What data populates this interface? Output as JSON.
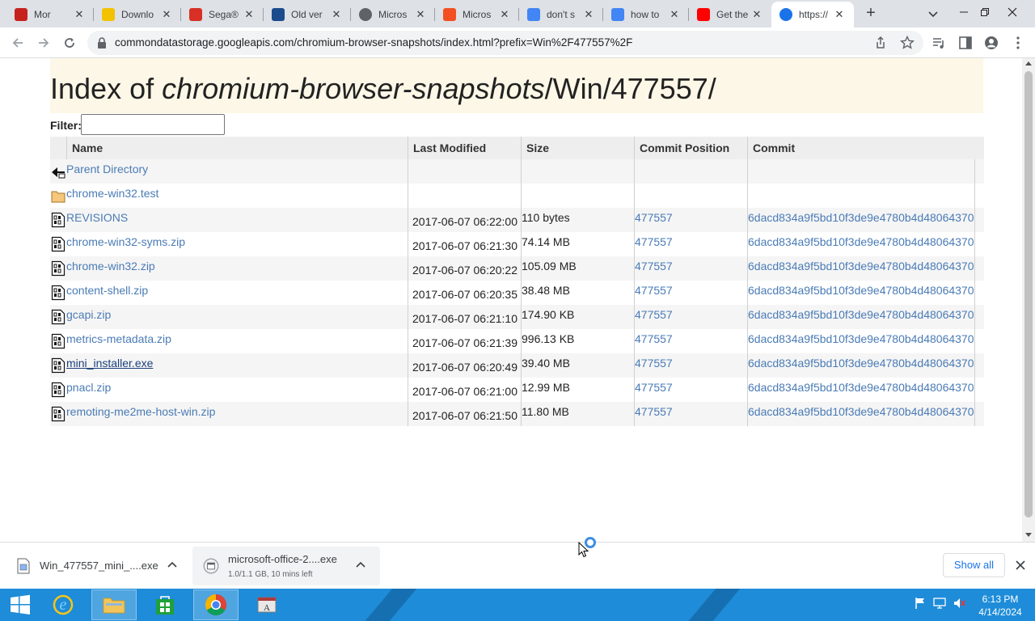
{
  "tabs": [
    {
      "title": "Mor",
      "favicon_color": "#c5221f",
      "favicon": "wolf-icon"
    },
    {
      "title": "Downlo",
      "favicon_color": "#f2c200",
      "favicon": "download-site-icon"
    },
    {
      "title": "Sega®",
      "favicon_color": "#d93025",
      "favicon": "sega-icon"
    },
    {
      "title": "Old ver",
      "favicon_color": "#1a4b8c",
      "favicon": "oldversion-icon"
    },
    {
      "title": "Micros",
      "favicon_color": "#5f6368",
      "favicon": "globe-icon"
    },
    {
      "title": "Micros",
      "favicon_color": "#f25022",
      "favicon": "microsoft-icon"
    },
    {
      "title": "don't s",
      "favicon_color": "#4285f4",
      "favicon": "google-icon"
    },
    {
      "title": "how to",
      "favicon_color": "#4285f4",
      "favicon": "google-icon"
    },
    {
      "title": "Get the",
      "favicon_color": "#ff0000",
      "favicon": "youtube-icon"
    },
    {
      "title": "https://",
      "favicon_color": "#1a73e8",
      "favicon": "globe-icon",
      "active": true
    }
  ],
  "address_bar": {
    "url": "commondatastorage.googleapis.com/chromium-browser-snapshots/index.html?prefix=Win%2F477557%2F"
  },
  "page": {
    "title_prefix": "Index of ",
    "title_italic": "chromium-browser-snapshots",
    "title_suffix": "/Win/477557/",
    "filter_label": "Filter:",
    "filter_value": "",
    "columns": [
      "Name",
      "Last Modified",
      "Size",
      "Commit Position",
      "Commit"
    ],
    "rows": [
      {
        "name": "Parent Directory",
        "date": "",
        "size": "",
        "position": "",
        "commit": "",
        "icon": "back-arrow-icon"
      },
      {
        "name": "chrome-win32.test",
        "date": "",
        "size": "",
        "position": "",
        "commit": "",
        "icon": "folder-icon"
      },
      {
        "name": "REVISIONS",
        "date": "2017-06-07 06:22:00",
        "size": "110 bytes",
        "position": "477557",
        "commit": "6dacd834a9f5bd10f3de9e4780b4d48064370",
        "icon": "binary-file-icon"
      },
      {
        "name": "chrome-win32-syms.zip",
        "date": "2017-06-07 06:21:30",
        "size": "74.14 MB",
        "position": "477557",
        "commit": "6dacd834a9f5bd10f3de9e4780b4d48064370",
        "icon": "binary-file-icon"
      },
      {
        "name": "chrome-win32.zip",
        "date": "2017-06-07 06:20:22",
        "size": "105.09 MB",
        "position": "477557",
        "commit": "6dacd834a9f5bd10f3de9e4780b4d48064370",
        "icon": "binary-file-icon"
      },
      {
        "name": "content-shell.zip",
        "date": "2017-06-07 06:20:35",
        "size": "38.48 MB",
        "position": "477557",
        "commit": "6dacd834a9f5bd10f3de9e4780b4d48064370",
        "icon": "binary-file-icon"
      },
      {
        "name": "gcapi.zip",
        "date": "2017-06-07 06:21:10",
        "size": "174.90 KB",
        "position": "477557",
        "commit": "6dacd834a9f5bd10f3de9e4780b4d48064370",
        "icon": "binary-file-icon"
      },
      {
        "name": "metrics-metadata.zip",
        "date": "2017-06-07 06:21:39",
        "size": "996.13 KB",
        "position": "477557",
        "commit": "6dacd834a9f5bd10f3de9e4780b4d48064370",
        "icon": "binary-file-icon"
      },
      {
        "name": "mini_installer.exe",
        "date": "2017-06-07 06:20:49",
        "size": "39.40 MB",
        "position": "477557",
        "commit": "6dacd834a9f5bd10f3de9e4780b4d48064370",
        "icon": "binary-file-icon",
        "visited": true
      },
      {
        "name": "pnacl.zip",
        "date": "2017-06-07 06:21:00",
        "size": "12.99 MB",
        "position": "477557",
        "commit": "6dacd834a9f5bd10f3de9e4780b4d48064370",
        "icon": "binary-file-icon"
      },
      {
        "name": "remoting-me2me-host-win.zip",
        "date": "2017-06-07 06:21:50",
        "size": "11.80 MB",
        "position": "477557",
        "commit": "6dacd834a9f5bd10f3de9e4780b4d48064370",
        "icon": "binary-file-icon"
      }
    ]
  },
  "downloads": {
    "items": [
      {
        "name": "Win_477557_mini_....exe",
        "status": ""
      },
      {
        "name": "microsoft-office-2....exe",
        "status": "1.0/1.1 GB, 10 mins left"
      }
    ],
    "show_all": "Show all"
  },
  "taskbar": {
    "apps": [
      "ie-icon",
      "file-explorer-icon",
      "store-icon",
      "chrome-icon",
      "document-viewer-icon"
    ],
    "time": "6:13 PM",
    "date": "4/14/2024"
  },
  "colors": {
    "link": "#4a7bb5",
    "title_bg": "#fdf7e7",
    "taskbar": "#1e8cd8",
    "tabstrip": "#dee1e6"
  }
}
